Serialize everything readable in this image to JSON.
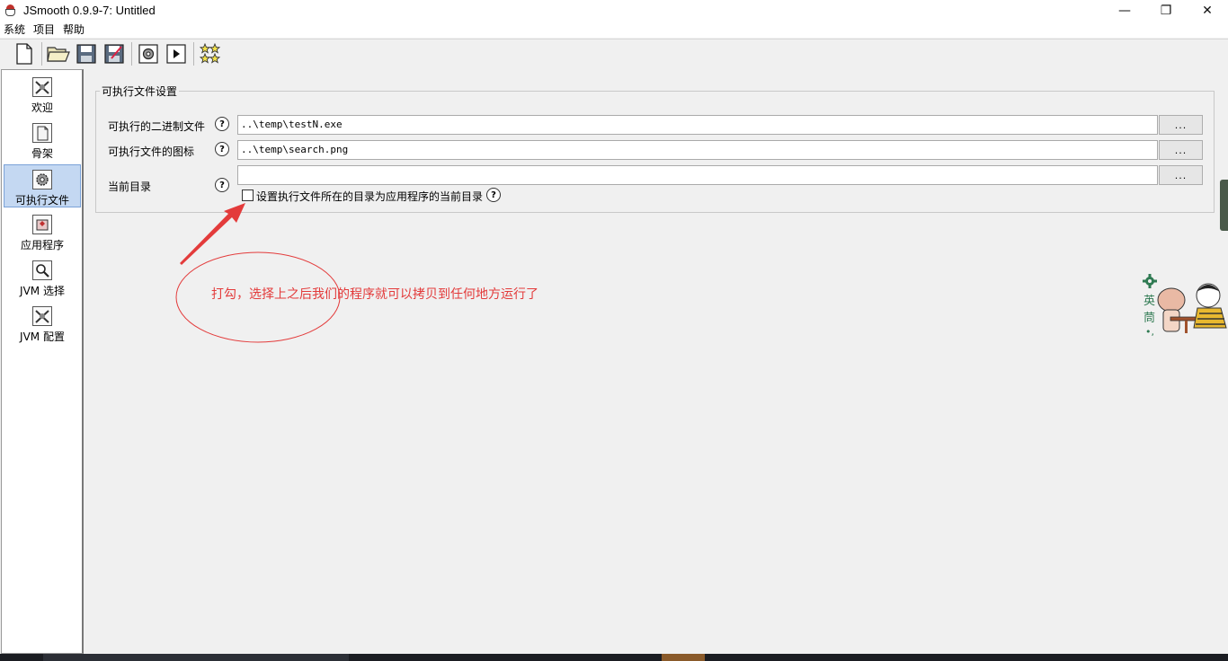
{
  "window": {
    "title": "JSmooth 0.9.9-7: Untitled",
    "minimize": "—",
    "maximize": "❐",
    "close": "✕"
  },
  "menu": {
    "items": [
      "系统",
      "项目",
      "帮助"
    ]
  },
  "toolbar": {
    "icons": [
      "new-file-icon",
      "open-folder-icon",
      "save-icon",
      "save-as-icon",
      "compile-icon",
      "run-icon",
      "stars-icon"
    ]
  },
  "sidebar": {
    "items": [
      {
        "label": "欢迎",
        "icon": "welcome-icon"
      },
      {
        "label": "骨架",
        "icon": "skeleton-icon"
      },
      {
        "label": "可执行文件",
        "icon": "executable-icon"
      },
      {
        "label": "应用程序",
        "icon": "application-icon"
      },
      {
        "label": "JVM 选择",
        "icon": "jvm-select-icon"
      },
      {
        "label": "JVM 配置",
        "icon": "jvm-config-icon"
      }
    ],
    "selected_index": 2
  },
  "exe_settings": {
    "group_title": "可执行文件设置",
    "binary_label": "可执行的二进制文件",
    "binary_value": "..\\temp\\testN.exe",
    "icon_label": "可执行文件的图标",
    "icon_value": "..\\temp\\search.png",
    "current_dir_label": "当前目录",
    "current_dir_value": "",
    "browse_label": "...",
    "help_glyph": "?",
    "checkbox_label": "设置执行文件所在的目录为应用程序的当前目录",
    "checkbox_checked": false
  },
  "annotation": {
    "text": "打勾，选择上之后我们的程序就可以拷贝到任何地方运行了",
    "color": "#e33b3b"
  },
  "decoration": {
    "chars": [
      "英",
      "茼",
      "•,"
    ],
    "accent": "#2f7a52"
  }
}
